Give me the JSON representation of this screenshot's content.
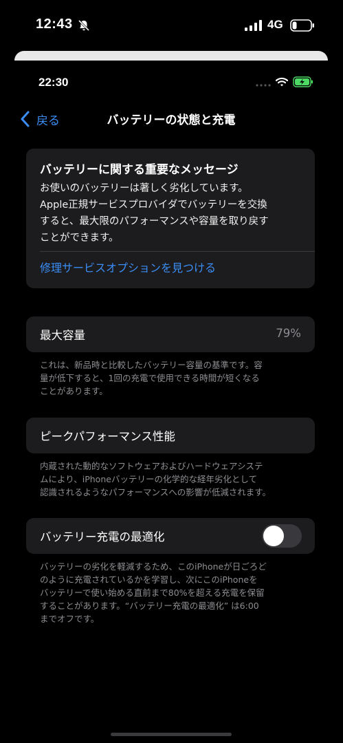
{
  "outer_status": {
    "time": "12:43",
    "network": "4G"
  },
  "inner_status": {
    "time": "22:30"
  },
  "nav": {
    "back_label": "戻る",
    "title": "バッテリーの状態と充電"
  },
  "message": {
    "title": "バッテリーに関する重要なメッセージ",
    "lines": [
      "お使いのバッテリーは著しく劣化しています。",
      "Apple正規サービスプロバイダでバッテリーを交換",
      "すると、最大限のパフォーマンスや容量を取り戻す",
      "ことができます。"
    ],
    "link": "修理サービスオプションを見つける"
  },
  "max_capacity": {
    "label": "最大容量",
    "value": "79%",
    "footnote_lines": [
      "これは、新品時と比較したバッテリー容量の基準です。容",
      "量が低下すると、1回の充電で使用できる時間が短くなる",
      "ことがあります。"
    ]
  },
  "peak_performance": {
    "label": "ピークパフォーマンス性能",
    "footnote_lines": [
      "内蔵された動的なソフトウェアおよびハードウェアシステ",
      "ムにより、iPhoneバッテリーの化学的な経年劣化として",
      "認識されるようなパフォーマンスへの影響が低減されます。"
    ]
  },
  "optimized_charging": {
    "label": "バッテリー充電の最適化",
    "enabled": false,
    "footnote_lines": [
      "バッテリーの劣化を軽減するため、このiPhoneが日ごろど",
      "のように充電されているかを学習し、次にこのiPhoneを",
      "バッテリーで使い始める直前まで80%を超える充電を保留",
      "することがあります。“バッテリー充電の最適化” は6:00",
      "までオフです。"
    ]
  },
  "icons": {
    "bell": "bell-slash-icon",
    "signal": "cellular-signal-icon",
    "outer_battery": "battery-low-icon",
    "wifi": "wifi-icon",
    "inner_battery": "battery-charging-icon",
    "back": "chevron-left-icon"
  },
  "colors": {
    "accent": "#3a8ef6",
    "charging": "#4cd964",
    "group_bg": "#1c1c1e",
    "secondary_text": "#8e8e93"
  }
}
